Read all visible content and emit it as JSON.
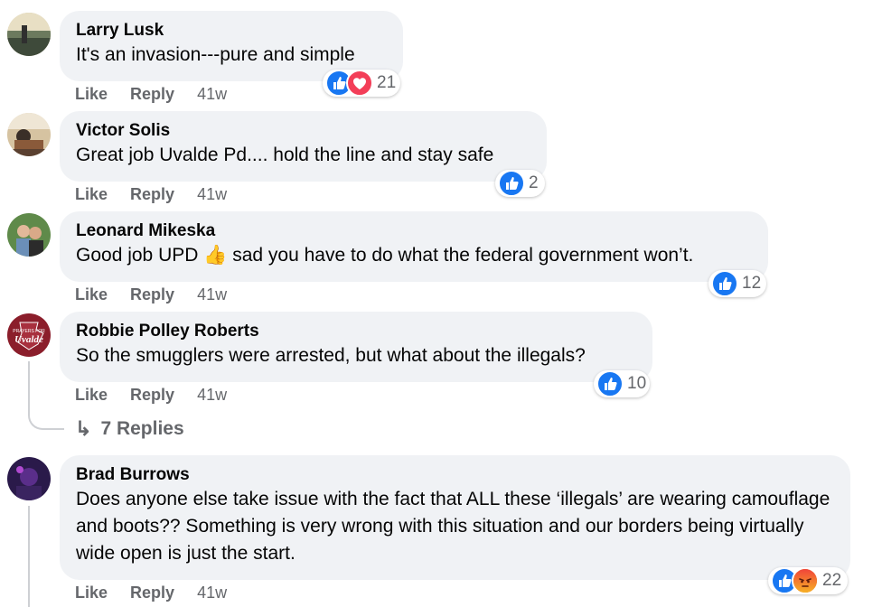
{
  "comments": [
    {
      "author": "Larry Lusk",
      "text": "It's an invasion---pure and simple",
      "reactions": [
        "like-icon",
        "love-icon"
      ],
      "reaction_count": "21",
      "like_label": "Like",
      "reply_label": "Reply",
      "time": "41w"
    },
    {
      "author": "Victor Solis",
      "text": "Great job Uvalde Pd.... hold the line and stay safe",
      "reactions": [
        "like-icon"
      ],
      "reaction_count": "2",
      "like_label": "Like",
      "reply_label": "Reply",
      "time": "41w"
    },
    {
      "author": "Leonard Mikeska",
      "text_before": "Good job UPD ",
      "emoji": "👍",
      "text_after": " sad you have to do what the federal government won’t.",
      "reactions": [
        "like-icon"
      ],
      "reaction_count": "12",
      "like_label": "Like",
      "reply_label": "Reply",
      "time": "41w"
    },
    {
      "author": "Robbie Polley Roberts",
      "text": "So the smugglers were arrested, but what about the illegals?",
      "reactions": [
        "like-icon"
      ],
      "reaction_count": "10",
      "like_label": "Like",
      "reply_label": "Reply",
      "time": "41w",
      "avatar_text": [
        "PRAYERS FOR",
        "Uvalde"
      ],
      "replies_label": "7 Replies"
    },
    {
      "author": "Brad Burrows",
      "text": "Does anyone else take issue with the fact that ALL these ‘illegals’ are wearing camouflage and boots?? Something is very wrong with this situation and our borders being virtually wide open is just the start.",
      "reactions": [
        "like-icon",
        "angry-icon"
      ],
      "reaction_count": "22",
      "like_label": "Like",
      "reply_label": "Reply",
      "time": "41w"
    }
  ],
  "colors": {
    "bubble": "#f0f2f5",
    "like_blue": "#1877f2",
    "love_red": "#f33e58",
    "angry_orange": "#e9710f",
    "meta_gray": "#65676b"
  }
}
